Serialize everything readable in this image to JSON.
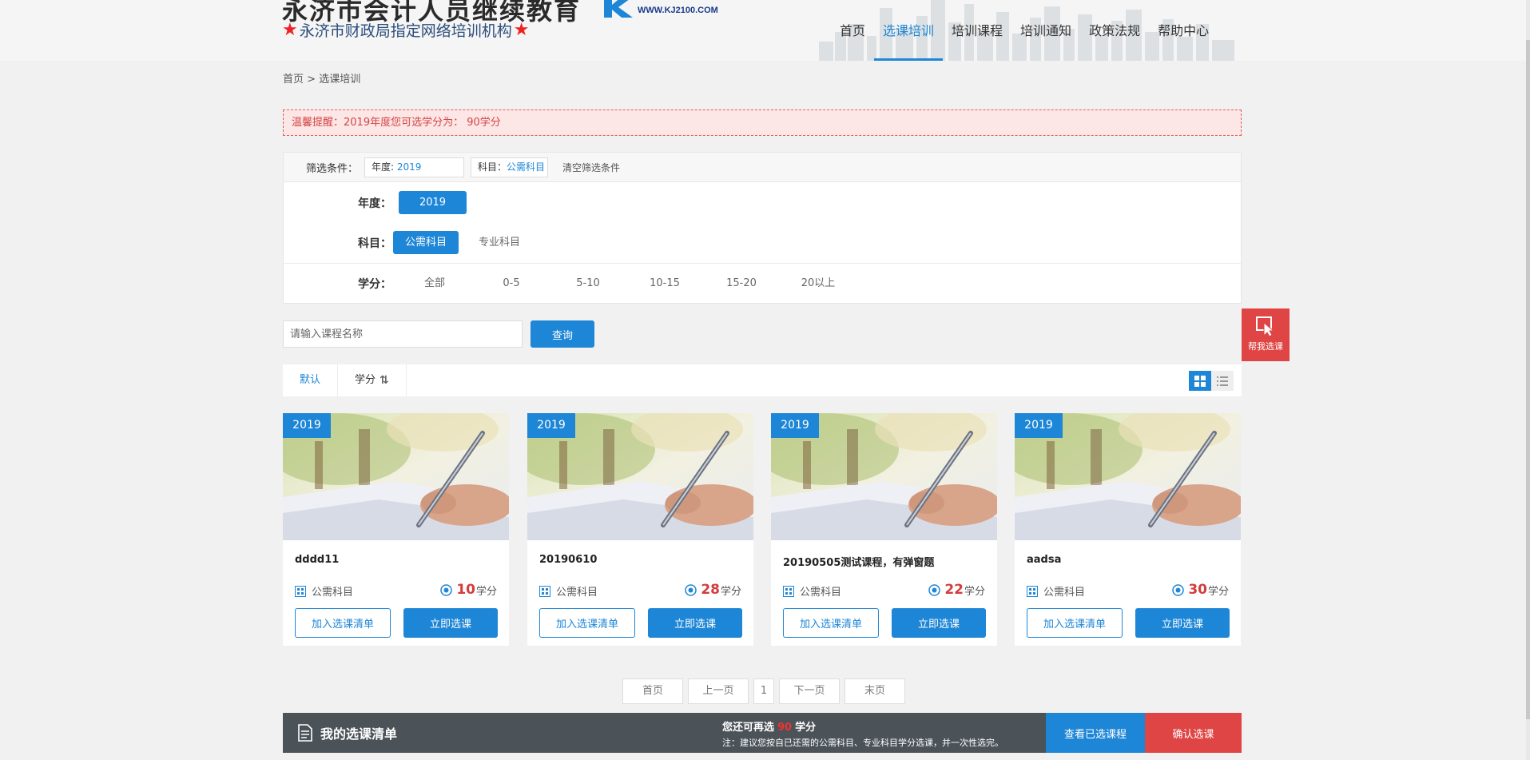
{
  "header": {
    "brand_title": "永济市会计人员继续教育",
    "logo_url_text": "WWW.KJ2100.COM",
    "brand_subtitle": "永济市财政局指定网络培训机构",
    "star_glyph": "★",
    "nav": [
      "首页",
      "选课培训",
      "培训课程",
      "培训通知",
      "政策法规",
      "帮助中心"
    ],
    "active_nav": "选课培训"
  },
  "breadcrumb": {
    "home": "首页",
    "separator": " > ",
    "current": "选课培训"
  },
  "notice": "温馨提醒：2019年度您可选学分为： 90学分",
  "filters": {
    "label": "筛选条件：",
    "chips": [
      {
        "key": "年度: ",
        "value": "2019"
      },
      {
        "key": "科目：",
        "value": "公需科目"
      }
    ],
    "clear_label": "清空筛选条件",
    "year": {
      "label": "年度：",
      "options": [
        "2019"
      ],
      "selected": "2019"
    },
    "subject": {
      "label": "科目：",
      "options": [
        "公需科目",
        "专业科目"
      ],
      "selected": "公需科目"
    },
    "credit": {
      "label": "学分：",
      "options": [
        "全部",
        "0-5",
        "5-10",
        "10-15",
        "15-20",
        "20以上"
      ]
    }
  },
  "search": {
    "placeholder": "请输入课程名称",
    "button_label": "查询"
  },
  "sort": {
    "items": [
      "默认",
      "学分"
    ],
    "active": "默认",
    "sort_icon": "sort-arrows-icon"
  },
  "view_toggle": {
    "modes": [
      "grid",
      "list"
    ],
    "active": "grid"
  },
  "courses": [
    {
      "year": "2019",
      "title": "dddd11",
      "category": "公需科目",
      "credit": "10",
      "credit_unit": "学分",
      "add_label": "加入选课清单",
      "select_label": "立即选课"
    },
    {
      "year": "2019",
      "title": "20190610",
      "category": "公需科目",
      "credit": "28",
      "credit_unit": "学分",
      "add_label": "加入选课清单",
      "select_label": "立即选课"
    },
    {
      "year": "2019",
      "title": "20190505测试课程，有弹窗题",
      "category": "公需科目",
      "credit": "22",
      "credit_unit": "学分",
      "add_label": "加入选课清单",
      "select_label": "立即选课"
    },
    {
      "year": "2019",
      "title": "aadsa",
      "category": "公需科目",
      "credit": "30",
      "credit_unit": "学分",
      "add_label": "加入选课清单",
      "select_label": "立即选课"
    }
  ],
  "pagination": {
    "first": "首页",
    "prev": "上一页",
    "current": "1",
    "next": "下一页",
    "last": "末页"
  },
  "bottom_bar": {
    "title": "我的选课清单",
    "remaining_prefix": "您还可再选",
    "remaining_value": "90",
    "remaining_suffix": "学分",
    "note": "注：建议您按自已还需的公需科目、专业科目学分选课，并一次性选完。",
    "view_label": "查看已选课程",
    "confirm_label": "确认选课"
  },
  "float_help": {
    "label": "帮我选课"
  },
  "colors": {
    "primary": "#1e86d6",
    "danger": "#e04545",
    "credit_number": "#d43c3c",
    "bottom_bar_bg": "#4b5258"
  }
}
